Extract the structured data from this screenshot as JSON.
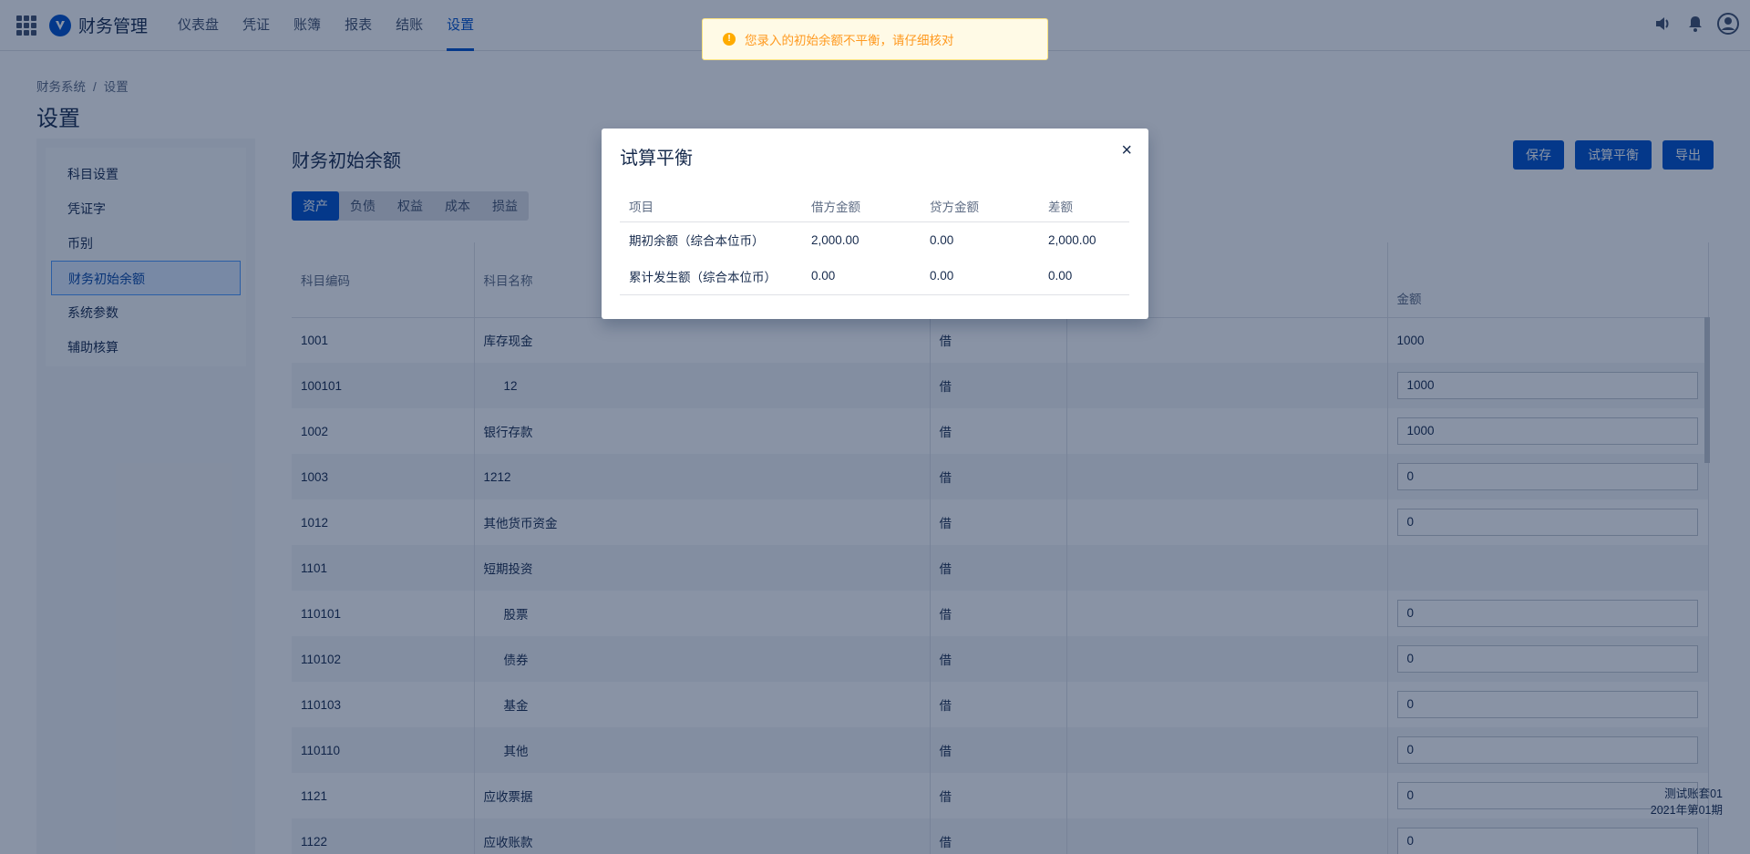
{
  "app": {
    "title": "财务管理"
  },
  "nav": [
    {
      "label": "仪表盘",
      "active": false
    },
    {
      "label": "凭证",
      "active": false
    },
    {
      "label": "账簿",
      "active": false
    },
    {
      "label": "报表",
      "active": false
    },
    {
      "label": "结账",
      "active": false
    },
    {
      "label": "设置",
      "active": true
    }
  ],
  "breadcrumb": {
    "root": "财务系统",
    "separator": "/",
    "current": "设置"
  },
  "page_title": "设置",
  "sidebar": {
    "items": [
      {
        "label": "科目设置",
        "active": false
      },
      {
        "label": "凭证字",
        "active": false
      },
      {
        "label": "币别",
        "active": false
      },
      {
        "label": "财务初始余额",
        "active": true
      },
      {
        "label": "系统参数",
        "active": false
      },
      {
        "label": "辅助核算",
        "active": false
      }
    ]
  },
  "content": {
    "title": "财务初始余额",
    "tabs": [
      {
        "label": "资产",
        "active": true
      },
      {
        "label": "负债",
        "active": false
      },
      {
        "label": "权益",
        "active": false
      },
      {
        "label": "成本",
        "active": false
      },
      {
        "label": "损益",
        "active": false
      }
    ],
    "actions": {
      "save": "保存",
      "trial_balance": "试算平衡",
      "export": "导出"
    }
  },
  "table": {
    "headers": {
      "code": "科目编码",
      "name": "科目名称",
      "direction": "",
      "col4": "",
      "amount": "金额"
    },
    "rows": [
      {
        "code": "1001",
        "name": "库存现金",
        "dir": "借",
        "amount": "1000",
        "input": false,
        "indent": false
      },
      {
        "code": "100101",
        "name": "12",
        "dir": "借",
        "amount": "1000",
        "input": true,
        "indent": true
      },
      {
        "code": "1002",
        "name": "银行存款",
        "dir": "借",
        "amount": "1000",
        "input": true,
        "indent": false
      },
      {
        "code": "1003",
        "name": "1212",
        "dir": "借",
        "amount": "0",
        "input": true,
        "indent": false
      },
      {
        "code": "1012",
        "name": "其他货币资金",
        "dir": "借",
        "amount": "0",
        "input": true,
        "indent": false
      },
      {
        "code": "1101",
        "name": "短期投资",
        "dir": "借",
        "amount": "",
        "input": false,
        "indent": false
      },
      {
        "code": "110101",
        "name": "股票",
        "dir": "借",
        "amount": "0",
        "input": true,
        "indent": true
      },
      {
        "code": "110102",
        "name": "债券",
        "dir": "借",
        "amount": "0",
        "input": true,
        "indent": true
      },
      {
        "code": "110103",
        "name": "基金",
        "dir": "借",
        "amount": "0",
        "input": true,
        "indent": true
      },
      {
        "code": "110110",
        "name": "其他",
        "dir": "借",
        "amount": "0",
        "input": true,
        "indent": true
      },
      {
        "code": "1121",
        "name": "应收票据",
        "dir": "借",
        "amount": "0",
        "input": true,
        "indent": false
      },
      {
        "code": "1122",
        "name": "应收账款",
        "dir": "借",
        "amount": "0",
        "input": true,
        "indent": false
      }
    ]
  },
  "toast": {
    "message": "您录入的初始余额不平衡，请仔细核对"
  },
  "modal": {
    "title": "试算平衡",
    "close": "×",
    "headers": [
      "项目",
      "借方金额",
      "贷方金额",
      "差额"
    ],
    "rows": [
      [
        "期初余额（综合本位币）",
        "2,000.00",
        "0.00",
        "2,000.00"
      ],
      [
        "累计发生额（综合本位币）",
        "0.00",
        "0.00",
        "0.00"
      ]
    ]
  },
  "footer": {
    "ledger": "测试账套01",
    "period": "2021年第01期"
  }
}
